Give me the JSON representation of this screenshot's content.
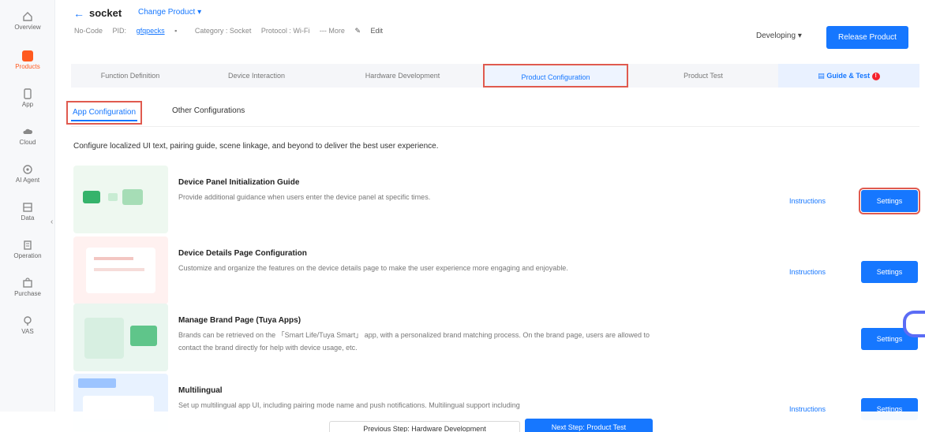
{
  "sidebar": {
    "items": [
      {
        "label": "Overview",
        "icon": "home-icon"
      },
      {
        "label": "Products",
        "icon": "product-icon",
        "active": true
      },
      {
        "label": "App",
        "icon": "app-icon"
      },
      {
        "label": "Cloud",
        "icon": "cloud-icon"
      },
      {
        "label": "AI Agent",
        "icon": "ai-agent-icon"
      },
      {
        "label": "Data",
        "icon": "data-icon"
      },
      {
        "label": "Operation",
        "icon": "operation-icon"
      },
      {
        "label": "Purchase",
        "icon": "purchase-icon"
      },
      {
        "label": "VAS",
        "icon": "vas-icon"
      }
    ]
  },
  "header": {
    "product_name": "socket",
    "change_product": "Change Product",
    "meta": {
      "no_code": "No-Code",
      "pid_label": "PID: ",
      "pid": "gfqpecks",
      "category": "Category : Socket",
      "protocol": "Protocol : Wi-Fi",
      "more": "--- More",
      "edit": "Edit"
    },
    "status": "Developing",
    "release_button": "Release Product"
  },
  "steps": [
    "Function Definition",
    "Device Interaction",
    "Hardware Development",
    "Product Configuration",
    "Product Test",
    "Guide & Test"
  ],
  "guide_badge": "!",
  "subtabs": {
    "app": "App Configuration",
    "other": "Other Configurations"
  },
  "intro": "Configure localized UI text, pairing guide, scene linkage, and beyond to deliver the best user experience.",
  "cards": [
    {
      "title": "Device Panel Initialization Guide",
      "desc": "Provide additional guidance when users enter the device panel at specific times.",
      "instructions": "Instructions",
      "settings": "Settings"
    },
    {
      "title": "Device Details Page Configuration",
      "desc": "Customize and organize the features on the device details page to make the user experience more engaging and enjoyable.",
      "instructions": "Instructions",
      "settings": "Settings"
    },
    {
      "title": "Manage Brand Page (Tuya Apps)",
      "desc": "Brands can be retrieved on the 「Smart Life/Tuya Smart」 app, with a personalized brand matching process. On the brand page, users are allowed to contact the brand directly for help with device usage, etc.",
      "instructions": "",
      "settings": "Settings"
    },
    {
      "title": "Multilingual",
      "desc": "Set up multilingual app UI, including pairing mode name and push notifications. Multilingual support including",
      "instructions": "Instructions",
      "settings": "Settings"
    }
  ],
  "footer": {
    "prev": "Previous Step: Hardware Development",
    "next": "Next Step: Product Test"
  },
  "colors": {
    "accent": "#1677ff",
    "highlight_box": "#e05a4f",
    "active_nav": "#ff5a1f"
  }
}
